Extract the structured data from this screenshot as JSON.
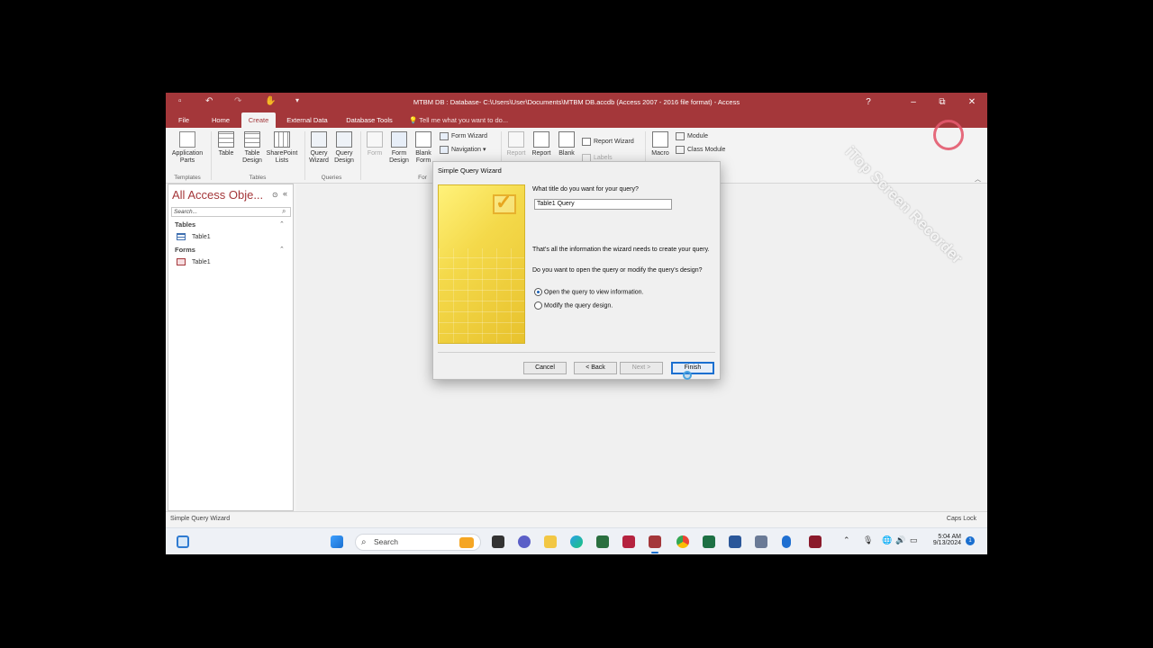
{
  "titlebar": {
    "title": "MTBM DB : Database- C:\\Users\\User\\Documents\\MTBM DB.accdb (Access 2007 - 2016 file format) - Access",
    "minimize": "–",
    "maximize": "⧉",
    "close": "✕",
    "help": "?"
  },
  "tabs": {
    "file": "File",
    "home": "Home",
    "create": "Create",
    "external": "External Data",
    "dbtools": "Database Tools",
    "tellme": "Tell me what you want to do..."
  },
  "ribbon": {
    "app_parts": "Application\nParts",
    "table": "Table",
    "table_design": "Table\nDesign",
    "sharepoint": "SharePoint\nLists",
    "query_wizard": "Query\nWizard",
    "query_design": "Query\nDesign",
    "form": "Form",
    "form_design": "Form\nDesign",
    "blank_form": "Blank\nForm",
    "form_wizard": "Form Wizard",
    "navigation": "Navigation",
    "report": "Report",
    "report_design": "Report",
    "blank_report": "Blank",
    "report_wizard": "Report Wizard",
    "labels": "Labels",
    "macro": "Macro",
    "module": "Module",
    "class_module": "Class Module",
    "groups": {
      "templates": "Templates",
      "tables": "Tables",
      "queries": "Queries",
      "forms": "For"
    }
  },
  "nav": {
    "title": "All Access Obje...",
    "search_placeholder": "Search...",
    "categories": [
      {
        "label": "Tables",
        "items": [
          "Table1"
        ]
      },
      {
        "label": "Forms",
        "items": [
          "Table1"
        ]
      }
    ]
  },
  "dialog": {
    "title": "Simple Query Wizard",
    "prompt": "What title do you want for your query?",
    "query_title": "Table1 Query",
    "info": "That's all the information the wizard needs to create your query.",
    "question": "Do you want to open the query or modify the query's design?",
    "option_open": "Open the query to view information.",
    "option_modify": "Modify the query design.",
    "selected_option": "open",
    "buttons": {
      "cancel": "Cancel",
      "back": "< Back",
      "next": "Next >",
      "finish": "Finish"
    }
  },
  "statusbar": {
    "left": "Simple Query Wizard",
    "right": "Caps Lock"
  },
  "taskbar": {
    "search": "Search",
    "time": "5:04 AM",
    "date": "9/13/2024",
    "notification_count": "1"
  },
  "watermark": {
    "text": "iTop Screen Recorder"
  },
  "colors": {
    "access_brand": "#a4373a",
    "dialog_art": "#f4d94a",
    "accent_blue": "#1a6fd0"
  }
}
